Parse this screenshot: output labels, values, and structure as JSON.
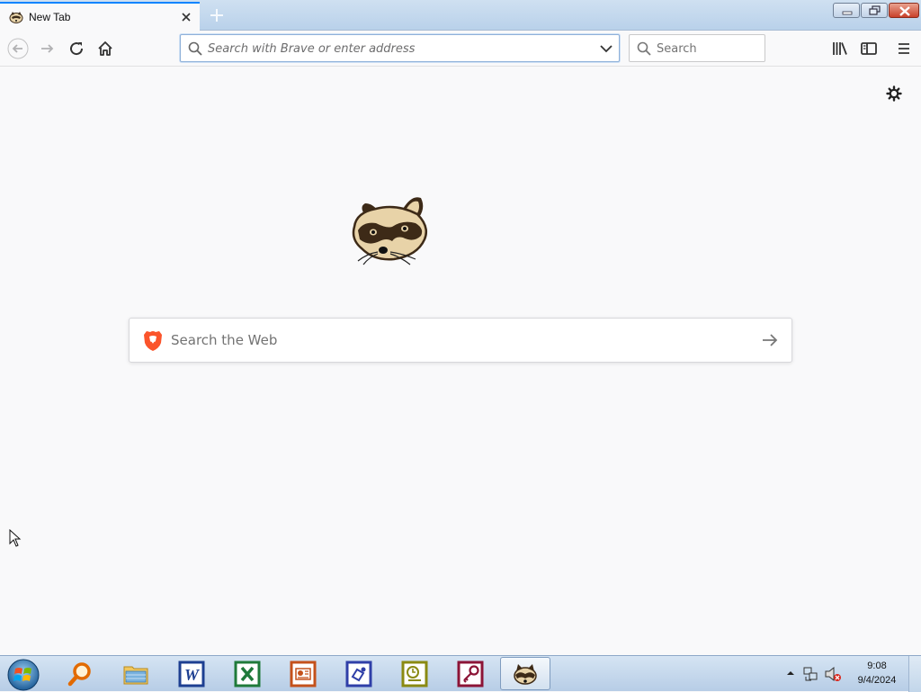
{
  "tab": {
    "title": "New Tab"
  },
  "urlbar": {
    "placeholder": "Search with Brave or enter address"
  },
  "searchbar": {
    "placeholder": "Search"
  },
  "newtab_page": {
    "search_placeholder": "Search the Web"
  },
  "taskbar": {
    "apps": [
      "search",
      "file-explorer",
      "word",
      "excel",
      "powerpoint",
      "visio",
      "project",
      "access",
      "browser"
    ],
    "time": "9:08",
    "date": "9/4/2024"
  },
  "colors": {
    "accent": "#0a84ff",
    "brave": "#fb542b"
  }
}
